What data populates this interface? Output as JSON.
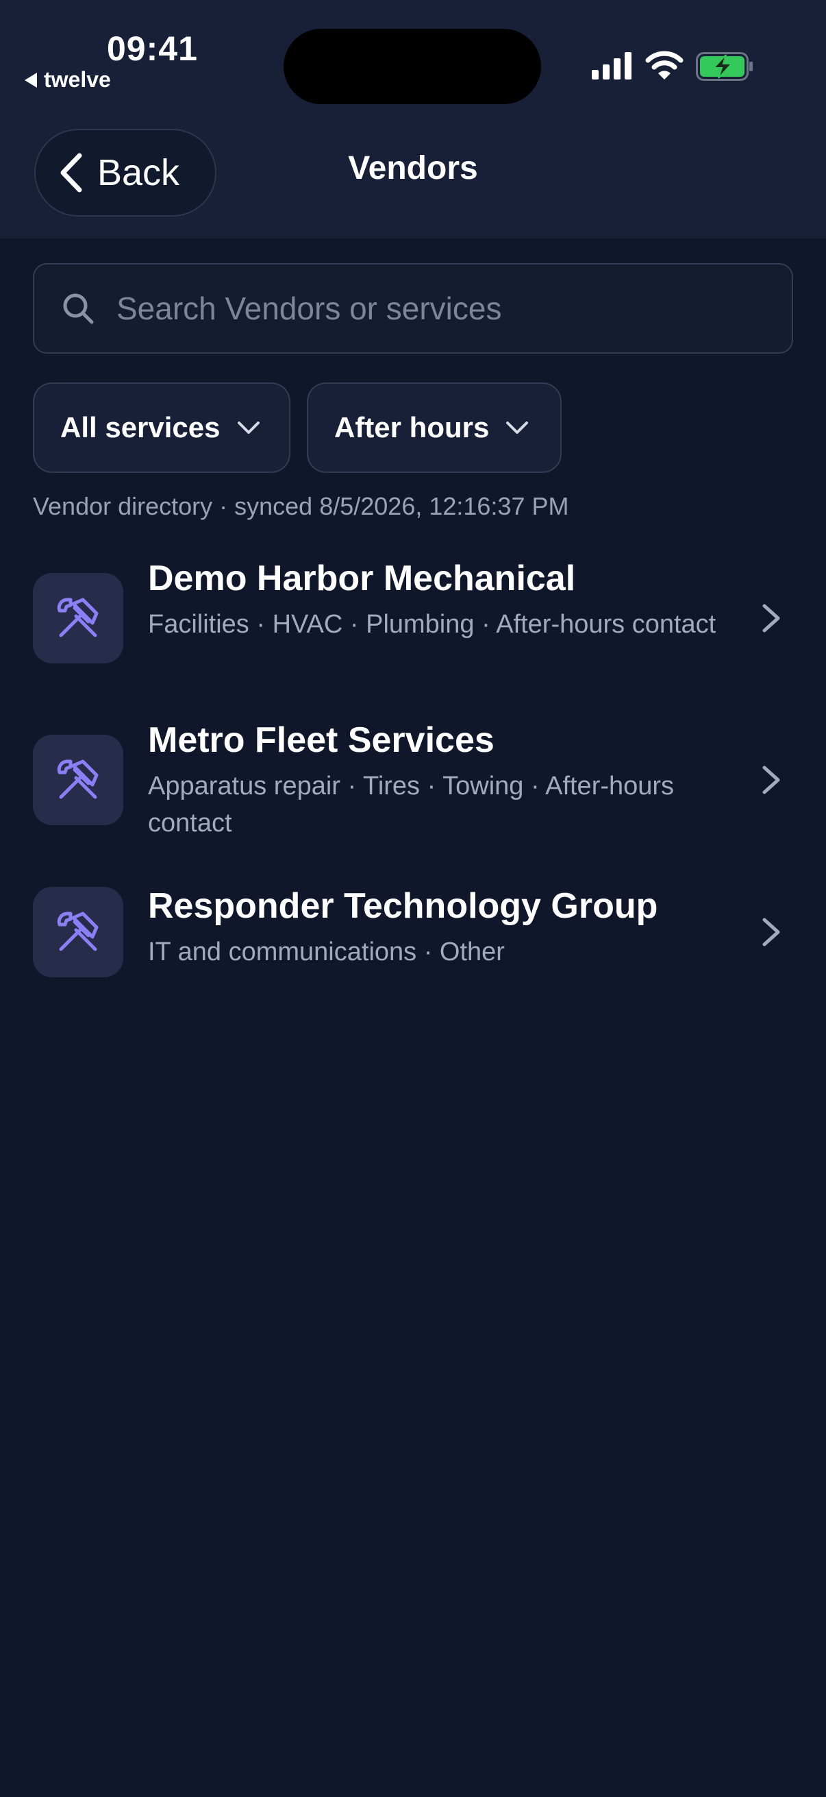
{
  "status_bar": {
    "time": "09:41",
    "back_app": "twelve"
  },
  "nav": {
    "back_label": "Back",
    "title": "Vendors"
  },
  "search": {
    "placeholder": "Search Vendors or services",
    "value": ""
  },
  "filters": [
    {
      "label": "All services"
    },
    {
      "label": "After hours"
    }
  ],
  "directory_status": "Vendor directory · synced 8/5/2026, 12:16:37 PM",
  "vendors": [
    {
      "name": "Demo Harbor Mechanical",
      "services": "Facilities · HVAC · Plumbing · After-hours contact"
    },
    {
      "name": "Metro Fleet Services",
      "services": "Apparatus repair · Tires · Towing · After-hours contact"
    },
    {
      "name": "Responder Technology Group",
      "services": "IT and communications · Other"
    }
  ],
  "colors": {
    "background": "#10172a",
    "header": "#172036",
    "accent_icon": "#8b7ff5",
    "icon_tile": "#272c4a",
    "battery_green": "#34c759"
  },
  "icons": {
    "vendor": "tools-icon",
    "search": "search-icon",
    "back": "chevron-left-icon",
    "filter": "chevron-down-icon",
    "row": "chevron-right-icon"
  }
}
